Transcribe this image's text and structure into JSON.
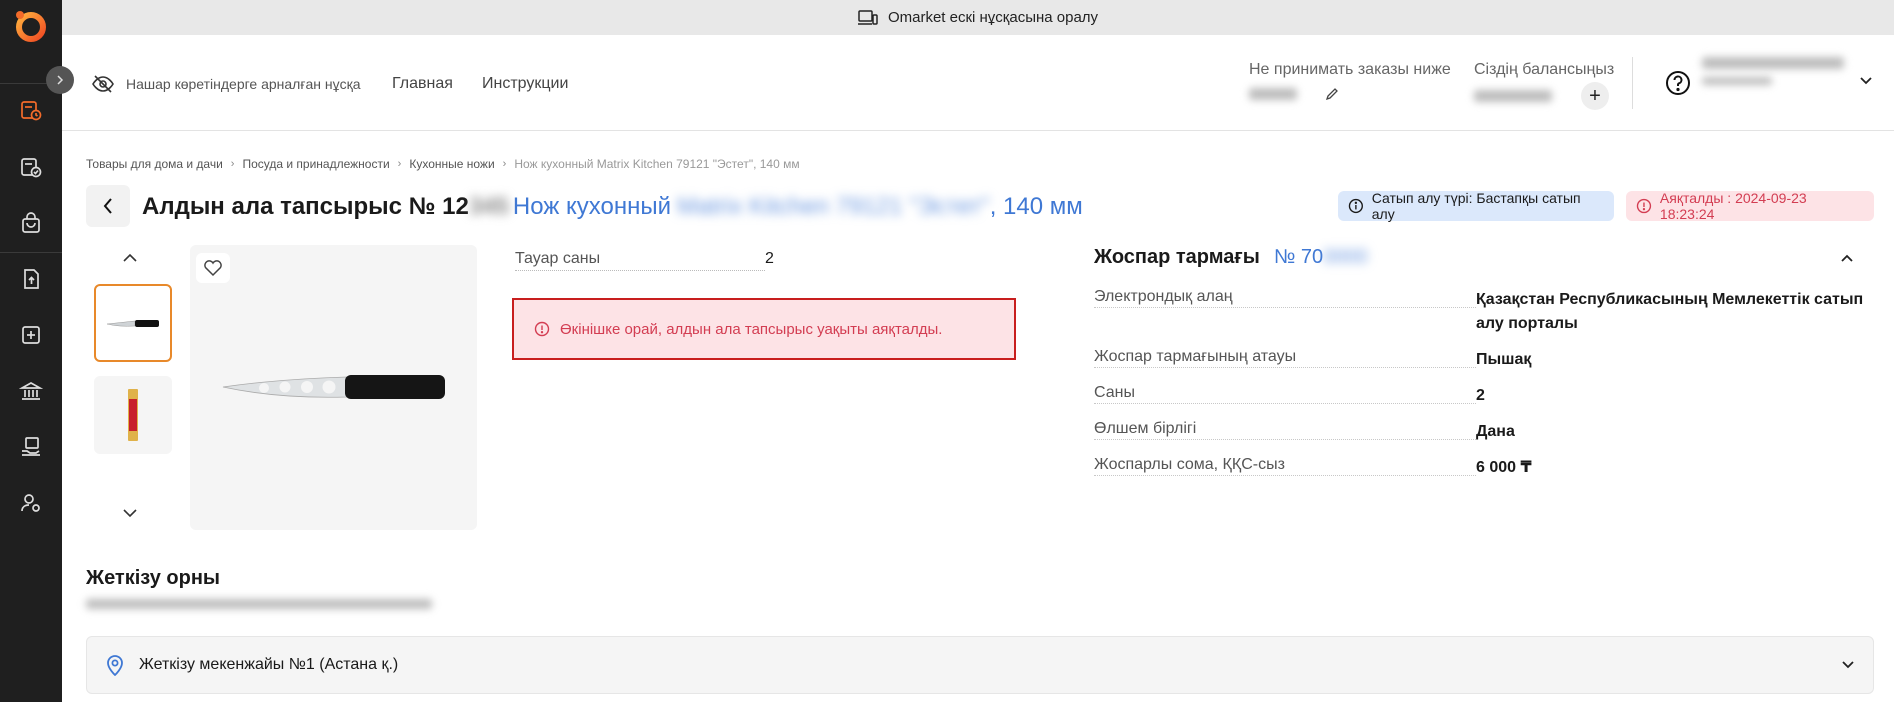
{
  "banner": {
    "text": "Omarket ескі нұсқасына оралу",
    "icon": "devices-icon"
  },
  "header": {
    "a11y_label": "Нашар көретіндерге арналған нұсқа",
    "nav": [
      "Главная",
      "Инструкции"
    ],
    "min_order_label": "Не принимать заказы ниже",
    "balance_label": "Сіздің балансыңыз",
    "plus": "+"
  },
  "breadcrumbs": [
    "Товары для дома и дачи",
    "Посуда и принадлежности",
    "Кухонные ножи",
    "Нож кухонный Matrix Kitchen 79121 \"Эстет\", 140 мм"
  ],
  "title": {
    "prefix": "Алдын ала тапсырыс № 12",
    "product_prefix": "Нож кухонный",
    "product_suffix": ", 140 мм"
  },
  "badges": {
    "purchase_type": "Сатып алу түрі: Бастапқы сатып алу",
    "ended": "Аяқталды : 2024-09-23 18:23:24"
  },
  "product": {
    "qty_label": "Тауар саны",
    "qty_value": "2"
  },
  "error": "Өкінішке орай, алдын ала тапсырыс уақыты аяқталды.",
  "plan": {
    "title": "Жоспар тармағы",
    "number_prefix": "№ 70",
    "rows": [
      {
        "label": "Электрондық алаң",
        "value": "Қазақстан Республикасының Мемлекеттік сатып алу порталы"
      },
      {
        "label": "Жоспар тармағының атауы",
        "value": "Пышақ"
      },
      {
        "label": "Саны",
        "value": "2"
      },
      {
        "label": "Өлшем бірлігі",
        "value": "Дана"
      },
      {
        "label": "Жоспарлы сома, ҚҚС-сыз",
        "value": "6 000 ₸"
      }
    ]
  },
  "delivery": {
    "title": "Жеткізу орны",
    "address_card": "Жеткізу мекенжайы №1 (Астана қ.)"
  },
  "colors": {
    "accent": "#3f78d4",
    "danger": "#d33d52",
    "sidebar": "#1f1f1f",
    "brand": "#f26b2a"
  }
}
